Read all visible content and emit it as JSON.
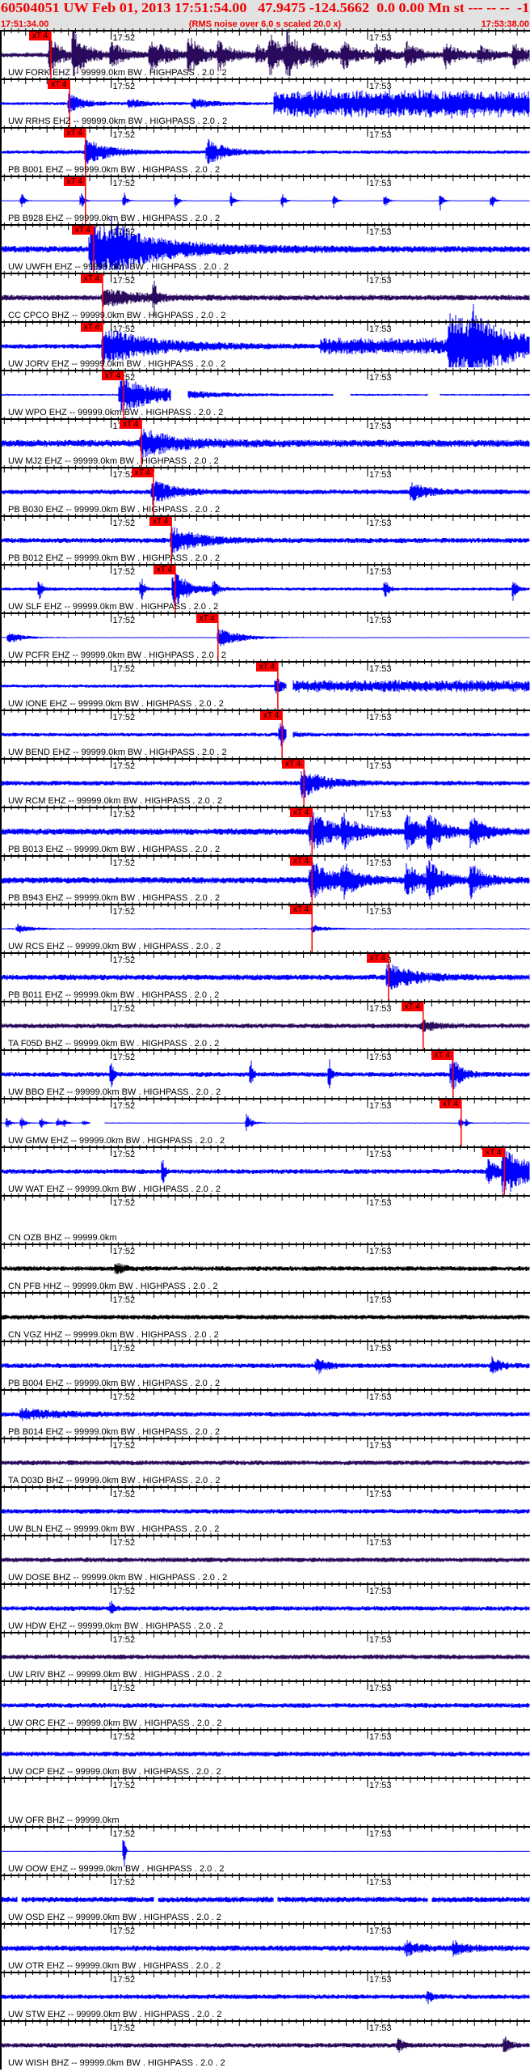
{
  "header": {
    "title": "60504051 UW Feb 01, 2013 17:51:54.00   47.9475 -124.5662  0.0 0.00 Mn st --- -- --  -1",
    "start_time": "17:51:34.00",
    "end_time": "17:53:38.00",
    "rms_note": "(RMS noise over 6.0 s scaled 20.0 x)"
  },
  "axis": {
    "window_seconds": 124,
    "tick_labels": [
      {
        "label": "17:52",
        "seconds": 26
      },
      {
        "label": "17:53",
        "seconds": 86
      }
    ]
  },
  "pick_label": "xT 4",
  "colors": {
    "blue": "#0000ff",
    "navy": "#2a0a5c",
    "black": "#000000",
    "pick": "#ff0000",
    "header_text": "#f00000"
  },
  "traces": [
    {
      "label": "UW FORK EHZ -- 99999.0km BW . HIGHPASS . 2.0 . 2",
      "color": "navy",
      "pick_seconds": 11.9
    },
    {
      "label": "UW RRHS EHZ -- 99999.0km BW . HIGHPASS . 2.0 . 2",
      "color": "blue",
      "pick_seconds": 16.3
    },
    {
      "label": "PB B001 EHZ -- 99999.0km BW . HIGHPASS . 2.0 . 2",
      "color": "blue",
      "pick_seconds": 20.0
    },
    {
      "label": "PB B928 EHZ -- 99999.0km BW . HIGHPASS . 2.0 . 2",
      "color": "blue",
      "pick_seconds": 20.0
    },
    {
      "label": "UW UWFH EHZ -- 99999.0km BW . HIGHPASS . 2.0 . 2",
      "color": "blue",
      "pick_seconds": 21.9
    },
    {
      "label": "CC CPCO BHZ -- 99999.0km BW . HIGHPASS . 2.0 . 2",
      "color": "navy",
      "pick_seconds": 24.0
    },
    {
      "label": "UW JORV EHZ -- 99999.0km BW . HIGHPASS . 2.0 . 2",
      "color": "blue",
      "pick_seconds": 24.0
    },
    {
      "label": "UW WPO EHZ -- 99999.0km BW . HIGHPASS . 2.0 . 2",
      "color": "blue",
      "pick_seconds": 28.9
    },
    {
      "label": "UW MJ2 EHZ -- 99999.0km BW . HIGHPASS . 2.0 . 2",
      "color": "blue",
      "pick_seconds": 33.1
    },
    {
      "label": "PB B030 EHZ -- 99999.0km BW . HIGHPASS . 2.0 . 2",
      "color": "blue",
      "pick_seconds": 35.9
    },
    {
      "label": "PB B012 EHZ -- 99999.0km BW . HIGHPASS . 2.0 . 2",
      "color": "blue",
      "pick_seconds": 40.1
    },
    {
      "label": "UW SLF EHZ -- 99999.0km BW . HIGHPASS . 2.0 . 2",
      "color": "blue",
      "pick_seconds": 41.0
    },
    {
      "label": "UW PCFR EHZ -- 99999.0km BW . HIGHPASS . 2.0 . 2",
      "color": "blue",
      "pick_seconds": 51.0
    },
    {
      "label": "UW IONE EHZ -- 99999.0km BW . HIGHPASS . 2.0 . 2",
      "color": "blue",
      "pick_seconds": 65.0
    },
    {
      "label": "UW BEND EHZ -- 99999.0km BW . HIGHPASS . 2.0 . 2",
      "color": "blue",
      "pick_seconds": 66.0
    },
    {
      "label": "UW RCM EHZ -- 99999.0km BW . HIGHPASS . 2.0 . 2",
      "color": "blue",
      "pick_seconds": 71.1
    },
    {
      "label": "PB B013 EHZ -- 99999.0km BW . HIGHPASS . 2.0 . 2",
      "color": "blue",
      "pick_seconds": 73.0
    },
    {
      "label": "PB B943 EHZ -- 99999.0km BW . HIGHPASS . 2.0 . 2",
      "color": "blue",
      "pick_seconds": 73.0
    },
    {
      "label": "UW RCS EHZ -- 99999.0km BW . HIGHPASS . 2.0 . 2",
      "color": "blue",
      "pick_seconds": 73.0
    },
    {
      "label": "PB B011 EHZ -- 99999.0km BW . HIGHPASS . 2.0 . 2",
      "color": "blue",
      "pick_seconds": 90.9
    },
    {
      "label": "TA F05D BHZ -- 99999.0km BW . HIGHPASS . 2.0 . 2",
      "color": "navy",
      "pick_seconds": 99.0
    },
    {
      "label": "UW BBO EHZ -- 99999.0km BW . HIGHPASS . 2.0 . 2",
      "color": "blue",
      "pick_seconds": 106.0
    },
    {
      "label": "UW GMW EHZ -- 99999.0km BW . HIGHPASS . 2.0 . 2",
      "color": "blue",
      "pick_seconds": 107.9
    },
    {
      "label": "UW WAT EHZ -- 99999.0km BW . HIGHPASS . 2.0 . 2",
      "color": "blue",
      "pick_seconds": 118.0
    },
    {
      "label": "CN OZB BHZ -- 99999.0km",
      "color": "black",
      "pick_seconds": null
    },
    {
      "label": "CN PFB HHZ -- 99999.0km BW . HIGHPASS . 2.0 . 2",
      "color": "black",
      "pick_seconds": null
    },
    {
      "label": "CN VGZ HHZ -- 99999.0km BW . HIGHPASS . 2.0 . 2",
      "color": "black",
      "pick_seconds": null
    },
    {
      "label": "PB B004 EHZ -- 99999.0km BW . HIGHPASS . 2.0 . 2",
      "color": "blue",
      "pick_seconds": null
    },
    {
      "label": "PB B014 EHZ -- 99999.0km BW . HIGHPASS . 2.0 . 2",
      "color": "blue",
      "pick_seconds": null
    },
    {
      "label": "TA D03D BHZ -- 99999.0km BW . HIGHPASS . 2.0 . 2",
      "color": "navy",
      "pick_seconds": null
    },
    {
      "label": "UW BLN EHZ -- 99999.0km BW . HIGHPASS . 2.0 . 2",
      "color": "blue",
      "pick_seconds": null
    },
    {
      "label": "UW DOSE BHZ -- 99999.0km BW . HIGHPASS . 2.0 . 2",
      "color": "navy",
      "pick_seconds": null
    },
    {
      "label": "UW HDW EHZ -- 99999.0km BW . HIGHPASS . 2.0 . 2",
      "color": "blue",
      "pick_seconds": null
    },
    {
      "label": "UW LRIV BHZ -- 99999.0km BW . HIGHPASS . 2.0 . 2",
      "color": "navy",
      "pick_seconds": null
    },
    {
      "label": "UW ORC EHZ -- 99999.0km BW . HIGHPASS . 2.0 . 2",
      "color": "blue",
      "pick_seconds": null
    },
    {
      "label": "UW OCP EHZ -- 99999.0km BW . HIGHPASS . 2.0 . 2",
      "color": "blue",
      "pick_seconds": null
    },
    {
      "label": "UW OFR BHZ -- 99999.0km",
      "color": "blue",
      "pick_seconds": null
    },
    {
      "label": "UW OOW EHZ -- 99999.0km BW . HIGHPASS . 2.0 . 2",
      "color": "blue",
      "pick_seconds": null
    },
    {
      "label": "UW OSD EHZ -- 99999.0km BW . HIGHPASS . 2.0 . 2",
      "color": "blue",
      "pick_seconds": null
    },
    {
      "label": "UW OTR EHZ -- 99999.0km BW . HIGHPASS . 2.0 . 2",
      "color": "blue",
      "pick_seconds": null
    },
    {
      "label": "UW STW EHZ -- 99999.0km BW . HIGHPASS . 2.0 . 2",
      "color": "blue",
      "pick_seconds": null
    },
    {
      "label": "UW WISH BHZ -- 99999.0km BW . HIGHPASS . 2.0 . 2",
      "color": "navy",
      "pick_seconds": null
    }
  ]
}
